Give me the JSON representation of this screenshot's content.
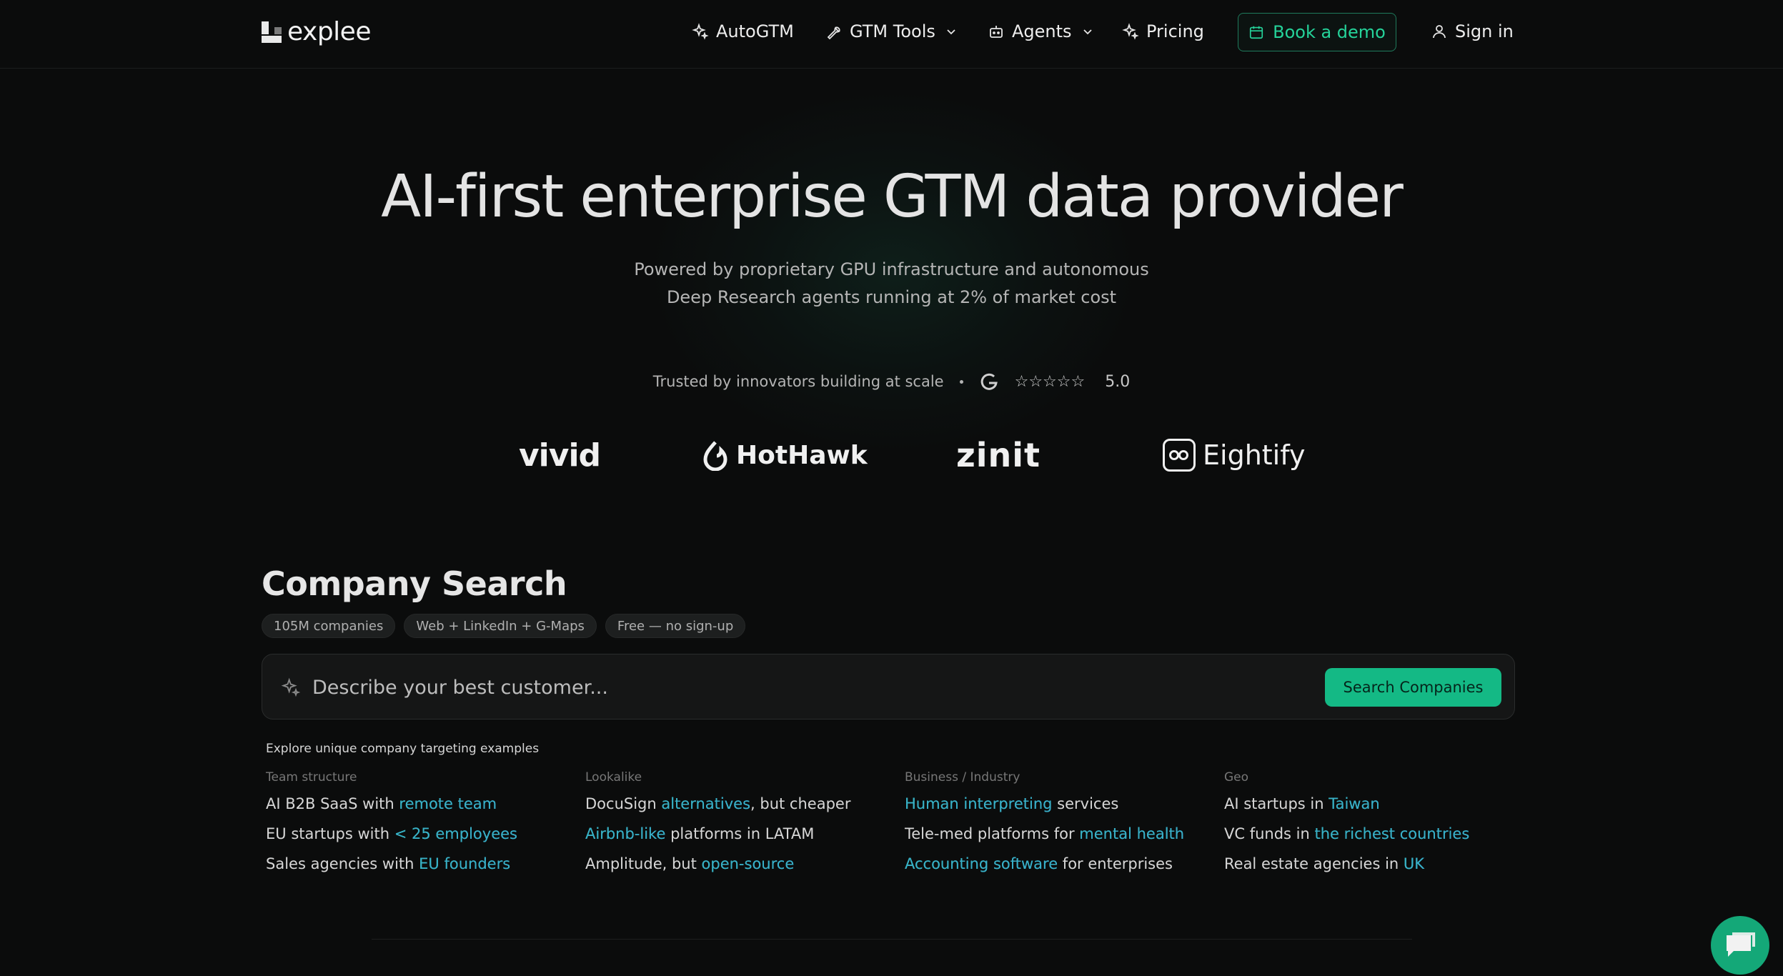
{
  "nav": {
    "logo_text": "explee",
    "items": [
      {
        "label": "AutoGTM",
        "icon": "sparkle-icon"
      },
      {
        "label": "GTM Tools",
        "icon": "wrench-icon"
      },
      {
        "label": "Agents",
        "icon": "bot-icon"
      },
      {
        "label": "Pricing",
        "icon": "sparkle-icon"
      }
    ],
    "demo_label": "Book a demo",
    "signin_label": "Sign in"
  },
  "hero": {
    "title": "AI-first enterprise GTM data provider",
    "subtitle_line1": "Powered by proprietary GPU infrastructure and autonomous",
    "subtitle_line2": "Deep Research agents running at 2% of market cost"
  },
  "trust": {
    "text": "Trusted by innovators building at scale",
    "rating": "5.0",
    "stars": "☆☆☆☆☆"
  },
  "brands": [
    "vivid",
    "HotHawk",
    "zinit",
    "Eightify"
  ],
  "company_search": {
    "title": "Company Search",
    "tags": [
      "105M companies",
      "Web + LinkedIn + G-Maps",
      "Free — no sign-up"
    ],
    "placeholder": "Describe your best customer...",
    "button_label": "Search Companies",
    "explore_label": "Explore unique company targeting examples",
    "columns": [
      {
        "heading": "Team structure",
        "examples": [
          {
            "pre": "AI B2B SaaS with ",
            "hl": "remote team",
            "post": ""
          },
          {
            "pre": "EU startups with ",
            "hl": "< 25 employees",
            "post": ""
          },
          {
            "pre": "Sales agencies with ",
            "hl": "EU founders",
            "post": ""
          }
        ]
      },
      {
        "heading": "Lookalike",
        "examples": [
          {
            "pre": "DocuSign ",
            "hl": "alternatives",
            "post": ", but cheaper"
          },
          {
            "pre": "",
            "hl": "Airbnb-like",
            "post": " platforms in LATAM"
          },
          {
            "pre": "Amplitude, but ",
            "hl": "open-source",
            "post": ""
          }
        ]
      },
      {
        "heading": "Business / Industry",
        "examples": [
          {
            "pre": "",
            "hl": "Human interpreting",
            "post": " services"
          },
          {
            "pre": "Tele-med platforms for ",
            "hl": "mental health",
            "post": ""
          },
          {
            "pre": "",
            "hl": "Accounting software",
            "post": " for enterprises"
          }
        ]
      },
      {
        "heading": "Geo",
        "examples": [
          {
            "pre": "AI startups in ",
            "hl": "Taiwan",
            "post": ""
          },
          {
            "pre": "VC funds in ",
            "hl": "the richest countries",
            "post": ""
          },
          {
            "pre": "Real estate agencies in ",
            "hl": "UK",
            "post": ""
          }
        ]
      }
    ]
  },
  "colors": {
    "accent": "#14b985",
    "accent_text": "#25d39a",
    "background": "#0b0c0c"
  }
}
